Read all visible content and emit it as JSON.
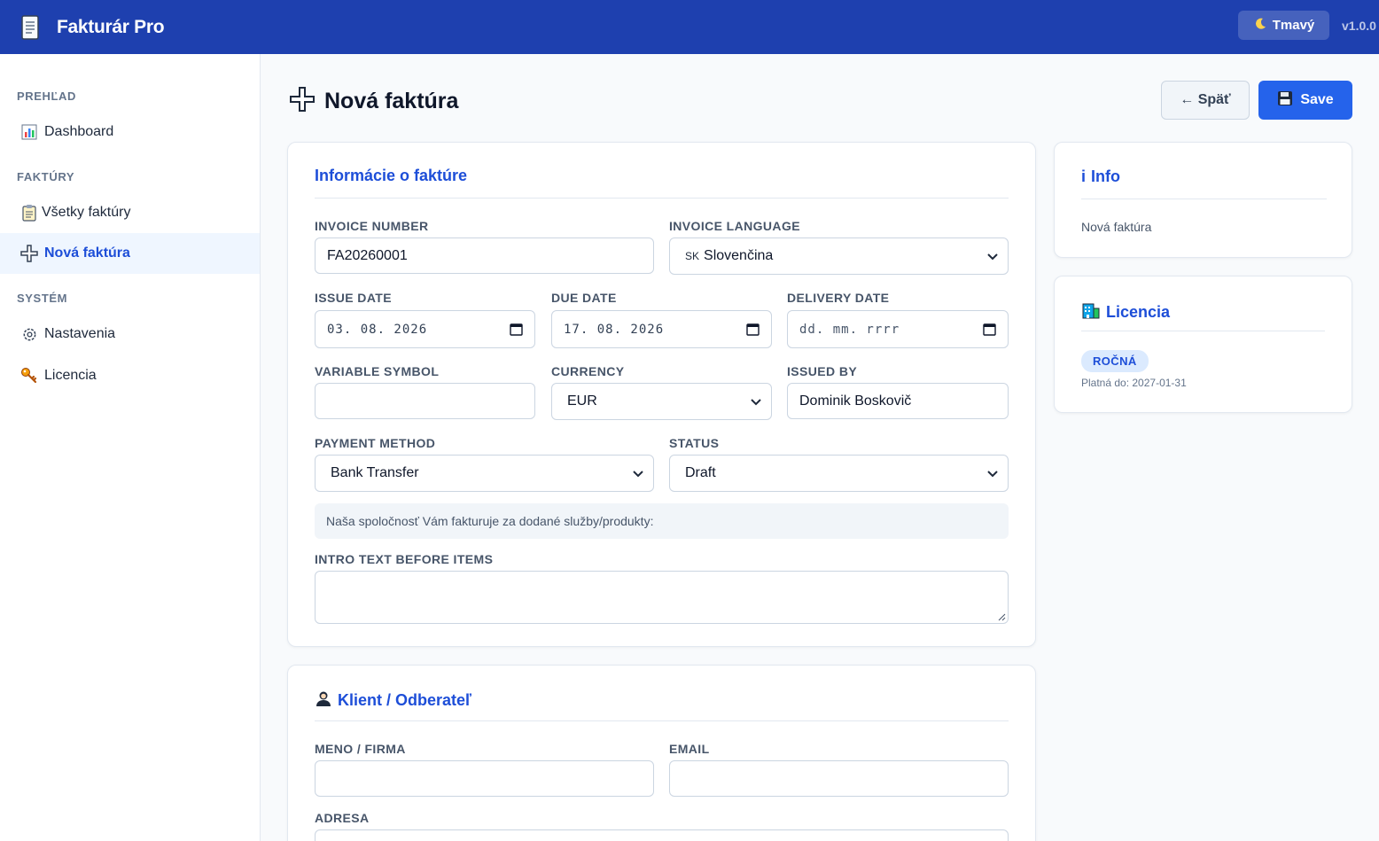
{
  "header": {
    "app_title": "Fakturár Pro",
    "theme_button": "Tmavý",
    "version": "v1.0.0"
  },
  "sidebar": {
    "sections": [
      {
        "title": "PREHĽAD",
        "items": [
          {
            "label": "Dashboard",
            "icon": "bar-chart-icon"
          }
        ]
      },
      {
        "title": "FAKTÚRY",
        "items": [
          {
            "label": "Všetky faktúry",
            "icon": "clipboard-icon"
          },
          {
            "label": "Nová faktúra",
            "icon": "plus-icon",
            "active": true
          }
        ]
      },
      {
        "title": "SYSTÉM",
        "items": [
          {
            "label": "Nastavenia",
            "icon": "gear-icon"
          },
          {
            "label": "Licencia",
            "icon": "key-icon"
          }
        ]
      }
    ]
  },
  "page": {
    "title": "Nová faktúra",
    "back_button": "← Späť",
    "save_button": "Save"
  },
  "invoice_card": {
    "title": "Informácie o faktúre",
    "invoice_number": {
      "label": "INVOICE NUMBER",
      "value": "FA20260001"
    },
    "invoice_language": {
      "label": "INVOICE LANGUAGE",
      "flag": "SK",
      "value": "Slovenčina"
    },
    "issue_date": {
      "label": "ISSUE DATE",
      "value": "03. 08. 2026"
    },
    "due_date": {
      "label": "DUE DATE",
      "value": "17. 08. 2026"
    },
    "delivery_date": {
      "label": "DELIVERY DATE",
      "placeholder": "dd. mm. rrrr"
    },
    "variable_symbol": {
      "label": "VARIABLE SYMBOL",
      "value": ""
    },
    "currency": {
      "label": "CURRENCY",
      "value": "EUR"
    },
    "issued_by": {
      "label": "ISSUED BY",
      "value": "Dominik Boskovič"
    },
    "payment_method": {
      "label": "PAYMENT METHOD",
      "value": "Bank Transfer"
    },
    "status": {
      "label": "STATUS",
      "value": "Draft"
    },
    "intro_note": "Naša spoločnosť Vám fakturuje za dodané služby/produkty:",
    "intro_text": {
      "label": "INTRO TEXT BEFORE ITEMS",
      "value": ""
    }
  },
  "client_card": {
    "title": "Klient / Odberateľ",
    "name": {
      "label": "MENO / FIRMA",
      "value": ""
    },
    "email": {
      "label": "EMAIL",
      "value": ""
    },
    "address": {
      "label": "ADRESA"
    }
  },
  "info_card": {
    "title": "Info",
    "icon_text": "i",
    "text": "Nová faktúra"
  },
  "license_card": {
    "title": "Licencia",
    "badge": "ROČNÁ",
    "valid_until": "Platná do: 2027-01-31"
  },
  "colors": {
    "header_bg": "#1e40af",
    "accent": "#2563eb",
    "title_blue": "#1d4ed8"
  }
}
